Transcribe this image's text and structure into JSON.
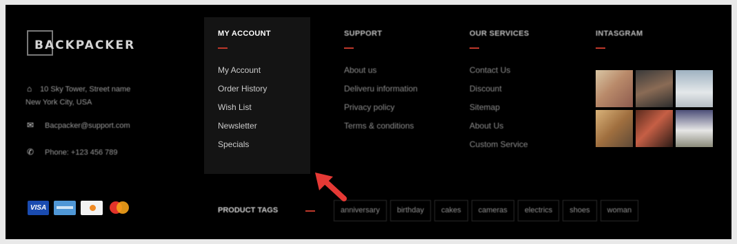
{
  "brand": {
    "logo_text": "BACKPACKER"
  },
  "contact": {
    "address_line1": "10 Sky Tower, Street name",
    "address_line2": "New York City, USA",
    "email": "Bacpacker@support.com",
    "phone": "Phone: +123 456 789"
  },
  "payments": {
    "visa": "VISA"
  },
  "my_account": {
    "title": "MY ACCOUNT",
    "items": [
      "My Account",
      "Order History",
      "Wish List",
      "Newsletter",
      "Specials"
    ]
  },
  "support": {
    "title": "SUPPORT",
    "items": [
      "About us",
      "Deliveru information",
      "Privacy policy",
      "Terms & conditions"
    ]
  },
  "services": {
    "title": "OUR SERVICES",
    "items": [
      "Contact Us",
      "Discount",
      "Sitemap",
      "About Us",
      "Custom Service"
    ]
  },
  "instagram": {
    "title": "INTASGRAM"
  },
  "tags": {
    "title": "PRODUCT TAGS",
    "items": [
      "anniversary",
      "birthday",
      "cakes",
      "cameras",
      "electrics",
      "shoes",
      "woman"
    ]
  },
  "colors": {
    "accent": "#c0392b",
    "arrow": "#e53935",
    "background": "#000000",
    "panel": "#141414"
  }
}
